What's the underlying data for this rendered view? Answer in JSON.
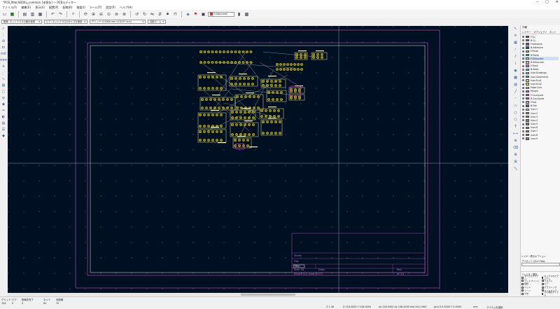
{
  "window": {
    "title": "*PCB_MatchBOXu_common [未保存] — PCBエディター"
  },
  "menu": [
    "ファイル(F)",
    "編集(E)",
    "表示(V)",
    "配置(P)",
    "配線(R)",
    "検査(I)",
    "ツール(T)",
    "設定(P)",
    "ヘルプ(H)"
  ],
  "toolbar": {
    "layer_name": "F.Silkscreen"
  },
  "options": {
    "track": "配線: ネットクラスの値を使用",
    "via": "ビア: ネットクラスのサイズを使用",
    "grid": "グリッド: 0.5000 mm (0.0197 inch)",
    "zoom": "自動ズーム"
  },
  "panel": {
    "header": "外観",
    "tabs": [
      "レイヤー",
      "オブジェクト",
      "ネット"
    ],
    "layers": [
      {
        "name": "F.Cu",
        "color": "#c83434"
      },
      {
        "name": "B.Cu",
        "color": "#4d7fc4"
      },
      {
        "name": "F.Adhesive",
        "color": "#8a4d8f"
      },
      {
        "name": "B.Adhesive",
        "color": "#0f57a0"
      },
      {
        "name": "F.Paste",
        "color": "#b4a07a"
      },
      {
        "name": "B.Paste",
        "color": "#00c2c2"
      },
      {
        "name": "F.Silkscreen",
        "color": "#f2eda1"
      },
      {
        "name": "B.Silkscreen",
        "color": "#e8b2a7"
      },
      {
        "name": "F.Mask",
        "color": "#d864ff"
      },
      {
        "name": "B.Mask",
        "color": "#02ffee"
      },
      {
        "name": "User.Drawings",
        "color": "#c2c2c2"
      },
      {
        "name": "User.Comments",
        "color": "#5994dc"
      },
      {
        "name": "User.Eco1",
        "color": "#b4db76"
      },
      {
        "name": "User.Eco2",
        "color": "#d8c852"
      },
      {
        "name": "Edge.Cuts",
        "color": "#d0d2cd"
      },
      {
        "name": "Margin",
        "color": "#ff26e2"
      },
      {
        "name": "F.Courtyard",
        "color": "#ff26e2"
      },
      {
        "name": "B.Courtyard",
        "color": "#ff26e2"
      },
      {
        "name": "F.Fab",
        "color": "#afafaf"
      },
      {
        "name": "B.Fab",
        "color": "#585d84"
      },
      {
        "name": "User.1",
        "color": "#c2c2c2"
      },
      {
        "name": "User.2",
        "color": "#7f7f7f"
      },
      {
        "name": "User.3",
        "color": "#7f7f7f"
      },
      {
        "name": "User.4",
        "color": "#7f7f7f"
      },
      {
        "name": "User.5",
        "color": "#7f7f7f"
      },
      {
        "name": "User.6",
        "color": "#7f7f7f"
      },
      {
        "name": "User.7",
        "color": "#7f7f7f"
      },
      {
        "name": "User.8",
        "color": "#7f7f7f"
      },
      {
        "name": "User.9",
        "color": "#7f7f7f"
      }
    ],
    "layer_display_options": "レイヤー表示オプション",
    "preset_label": "プリセット (Ctrl+Tab):",
    "preset_value": "",
    "filter_header": "フィルター選択",
    "filters": [
      "すべてのアイテム",
      "ロックされたアイテム",
      "フットプリント",
      "テキスト",
      "配線",
      "ビア",
      "パッド",
      "グラフィック",
      "ゾーン",
      "ルールエリア",
      "寸法",
      "その他のアイテム"
    ]
  },
  "status": {
    "grid_label": "グリッド",
    "grid_val": "194",
    "via_label": "ビア",
    "via_val": "0",
    "unrouted_label": "配線未完了",
    "unrouted_val": "0",
    "net_label": "ネット",
    "net_val": "62",
    "nc_label": "未配線",
    "nc_val": "70",
    "z": "Z 1.36",
    "xy": "X 216.5000  Y 108.0000",
    "dxy": "dx 216.5000  dy 108.0000  dist 242.1963",
    "grid": "grid X 0.5000  Y 0.5000",
    "units": "mm",
    "mode": "アイテムを選択"
  },
  "titleblock": {
    "sheet": "Sheet:",
    "file": "File:",
    "title": "Title:",
    "size": "Size: A4",
    "date": "Date:",
    "rev": "Rev:",
    "kicad": "KiCad E.D.A.  kicad (6.0.7)",
    "id": "Id: 1/1"
  }
}
